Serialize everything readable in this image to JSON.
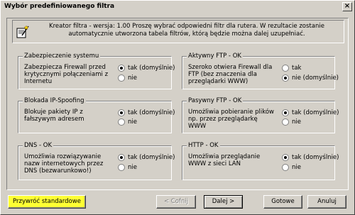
{
  "window": {
    "title": "Wybór predefiniowanego filtra",
    "close_glyph": "×"
  },
  "info": {
    "text": "Kreator filtra - wersja: 1.00  Proszę wybrać odpowiedni filtr dla rutera. W rezultacie zostanie automatycznie utworzona tabela filtrów, którą będzie można dalej uzupełniać.",
    "icon": "wizard-icon"
  },
  "groups": [
    {
      "title": "Zabezpieczenie systemu",
      "desc": "Zabezpiecza Firewall przed krytycznymi połączeniami z Internetu",
      "opt1": "tak (domyślnie)",
      "opt2": "nie",
      "selected": "opt1"
    },
    {
      "title": "Aktywny FTP - OK",
      "desc": "Szeroko otwiera Firewall dla FTP (bez znaczenia dla przeglądarki WWW)",
      "opt1": "tak",
      "opt2": "nie (domyślnie)",
      "selected": "opt2"
    },
    {
      "title": "Blokada IP-Spoofing",
      "desc": "Blokuje pakiety IP z fałszywym adresem",
      "opt1": "tak (domyślnie)",
      "opt2": "nie",
      "selected": "opt1"
    },
    {
      "title": "Pasywny FTP - OK",
      "desc": "Umożliwia pobieranie plików np. przez przeglądarkę WWW",
      "opt1": "tak (domyślnie)",
      "opt2": "nie",
      "selected": "opt1"
    },
    {
      "title": "DNS - OK",
      "desc": "Umożliwia rozwiązywanie nazw internetowych przez DNS (bezwarunkowo!)",
      "opt1": "tak (domyślnie)",
      "opt2": "nie",
      "selected": "opt1"
    },
    {
      "title": "HTTP - OK",
      "desc": "Umożliwia przeglądanie WWW z sieci LAN",
      "opt1": "tak (domyślnie)",
      "opt2": "nie",
      "selected": "opt1"
    }
  ],
  "buttons": {
    "restore": "Przywróć standardowe",
    "back": "< Cofnij",
    "next": "Dalej >",
    "finish": "Gotowe",
    "cancel": "Anuluj"
  },
  "colors": {
    "dialog_bg": "#d4d0c8",
    "restore_button_bg": "#ffff33"
  }
}
